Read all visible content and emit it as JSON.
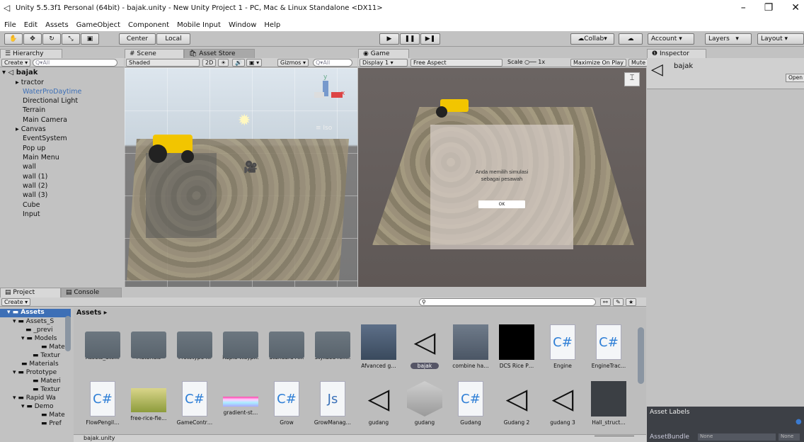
{
  "window": {
    "title": "Unity 5.5.3f1 Personal (64bit) - bajak.unity - New Unity Project 1 - PC, Mac & Linux Standalone <DX11>",
    "minimize": "–",
    "restore": "❐",
    "close": "✕"
  },
  "menu": [
    "File",
    "Edit",
    "Assets",
    "GameObject",
    "Component",
    "Mobile Input",
    "Window",
    "Help"
  ],
  "toolbar": {
    "center": "Center",
    "local": "Local",
    "collab": "Collab",
    "account": "Account",
    "layers": "Layers",
    "layout": "Layout"
  },
  "hierarchy": {
    "tab": "Hierarchy",
    "create": "Create",
    "search": "Q▾All",
    "scene": "bajak",
    "items": [
      "tractor",
      "WaterProDaytime",
      "Directional Light",
      "Terrain",
      "Main Camera",
      "Canvas",
      "EventSystem",
      "Pop up",
      "Main Menu",
      "wall",
      "wall (1)",
      "wall (2)",
      "wall (3)",
      "Cube",
      "Input"
    ]
  },
  "scene": {
    "tab": "Scene",
    "tab2": "Asset Store",
    "shaded": "Shaded",
    "mode2d": "2D",
    "gizmos": "Gizmos",
    "search": "Q▾All",
    "iso": "Iso",
    "axis_y": "y",
    "axis_x": "x"
  },
  "game": {
    "tab": "Game",
    "display": "Display 1",
    "aspect": "Free Aspect",
    "scale_label": "Scale",
    "scale_value": "1x",
    "maximize": "Maximize On Play",
    "mute": "Mute",
    "popup_text1": "Anda memilih simulasi",
    "popup_text2": "sebagai pesawah",
    "ok": "OK"
  },
  "inspector": {
    "tab": "Inspector",
    "name": "bajak",
    "open": "Open",
    "asset_labels": "Asset Labels",
    "asset_bundle": "AssetBundle",
    "none1": "None",
    "none2": "None"
  },
  "project": {
    "tab": "Project",
    "console": "Console",
    "create": "Create",
    "breadcrumb": "Assets",
    "arrow": "▸",
    "tree": [
      "Assets",
      "Assets_S",
      "_previ",
      "Models",
      "Mate",
      "Textur",
      "Materials",
      "Prototype",
      "Materi",
      "Textur",
      "Rapid Wa",
      "Demo",
      "Mate",
      "Pref"
    ],
    "row1": [
      "Assets_Sto…",
      "Materials",
      "Prototype …",
      "Rapid Wayp…",
      "Standard A…",
      "Stylized foli…",
      "Afvanced g…",
      "bajak",
      "combine ha…",
      "DCS Rice P…",
      "Engine",
      "EngineTrac…"
    ],
    "row2": [
      "FlowPengil…",
      "free-rice-fie…",
      "GameContr…",
      "gradient-st…",
      "Grow",
      "GrowManag…",
      "gudang",
      "gudang",
      "Gudang",
      "Gudang 2",
      "gudang 3",
      "Hall_struct…"
    ],
    "status": "bajak.unity"
  },
  "colors": {
    "selected": "#3d6fb6",
    "accent": "#2d6ec9",
    "cs": "#2f7fd6",
    "js": "#3970b8"
  }
}
